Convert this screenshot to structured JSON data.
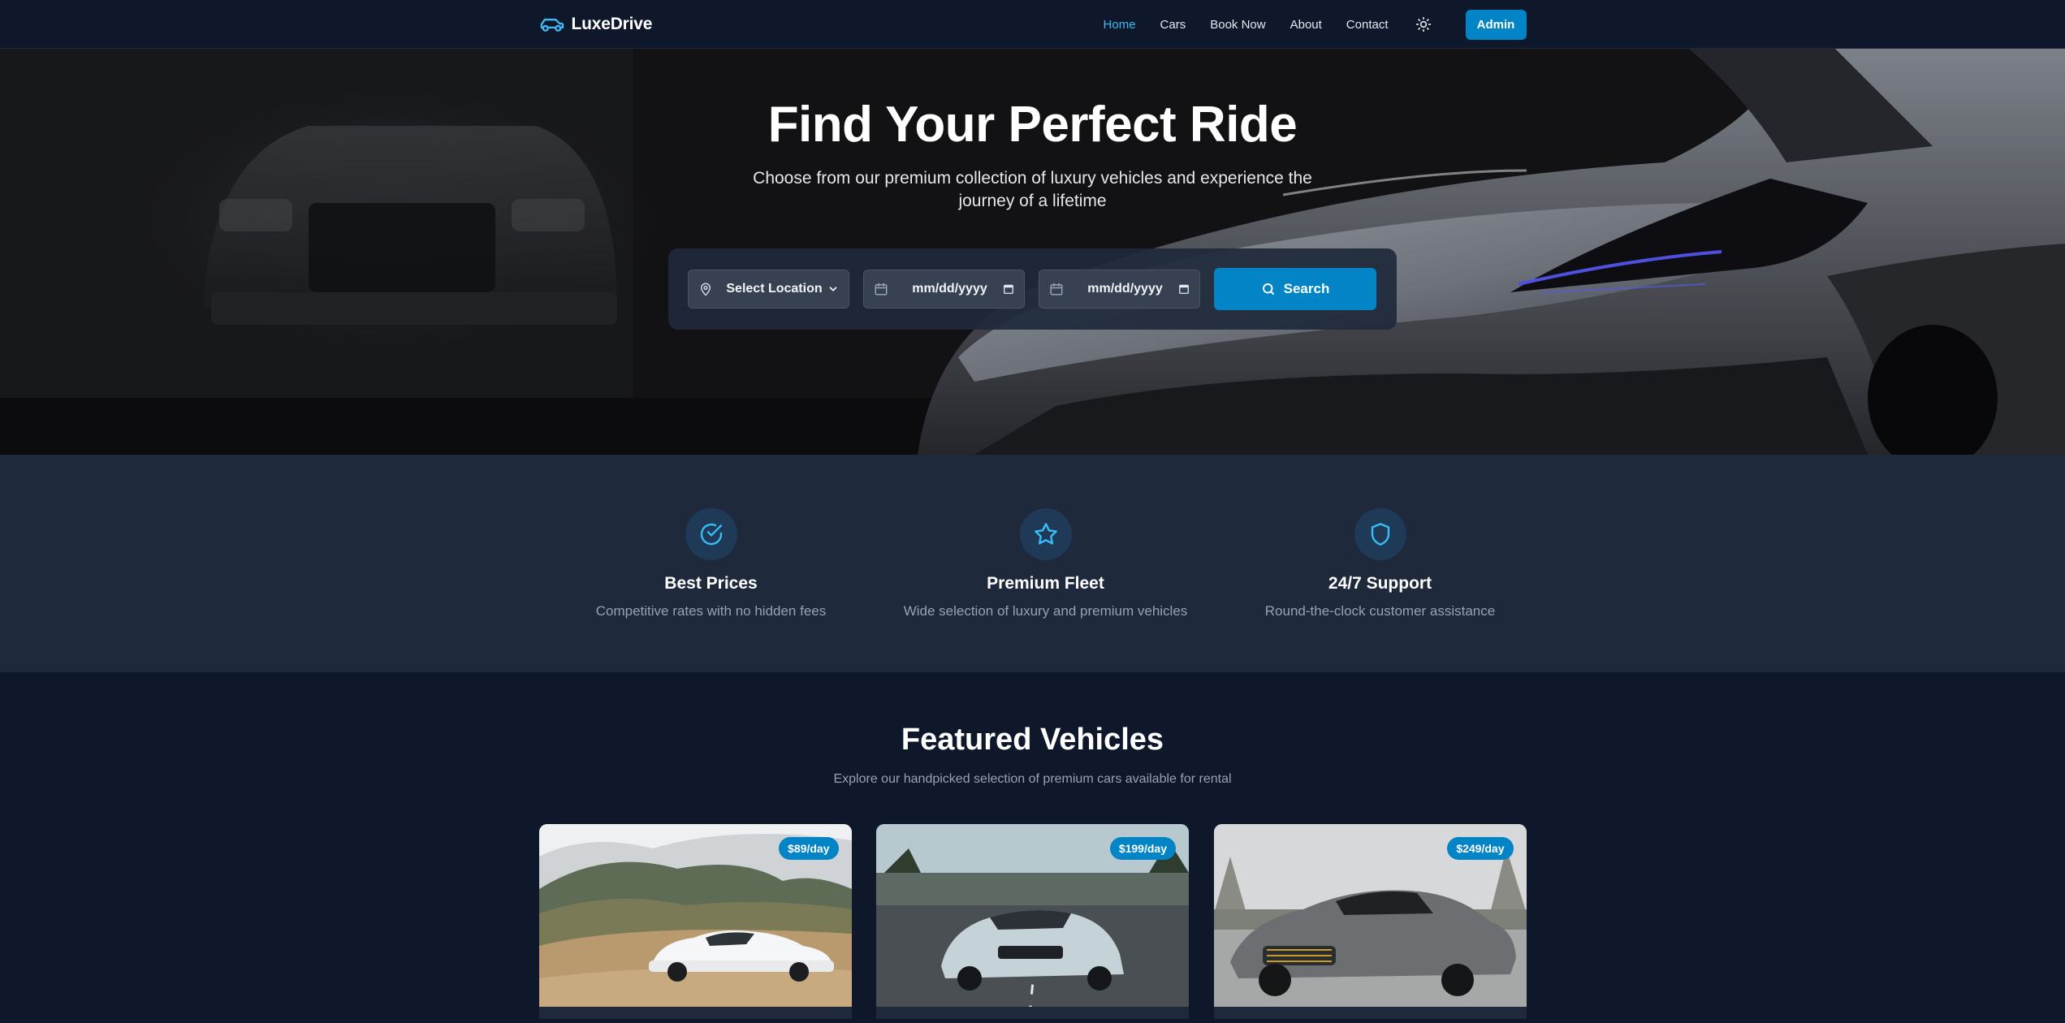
{
  "brand": {
    "name": "LuxeDrive",
    "icon": "car-icon"
  },
  "nav": {
    "links": [
      "Home",
      "Cars",
      "Book Now",
      "About",
      "Contact"
    ],
    "active": "Home",
    "theme_icon": "sun-icon",
    "admin_label": "Admin"
  },
  "hero": {
    "title": "Find Your Perfect Ride",
    "subtitle": "Choose from our premium collection of luxury vehicles and experience the journey of a lifetime",
    "search": {
      "location_placeholder": "Select Location",
      "pickup_date_placeholder": "mm/dd/yyyy",
      "return_date_placeholder": "mm/dd/yyyy",
      "button_label": "Search"
    }
  },
  "features": [
    {
      "icon": "check-circle-icon",
      "title": "Best Prices",
      "description": "Competitive rates with no hidden fees"
    },
    {
      "icon": "star-icon",
      "title": "Premium Fleet",
      "description": "Wide selection of luxury and premium vehicles"
    },
    {
      "icon": "shield-icon",
      "title": "24/7 Support",
      "description": "Round-the-clock customer assistance"
    }
  ],
  "featured": {
    "title": "Featured Vehicles",
    "subtitle": "Explore our handpicked selection of premium cars available for rental",
    "cars": [
      {
        "price": "$89/day"
      },
      {
        "price": "$199/day"
      },
      {
        "price": "$249/day"
      }
    ]
  },
  "colors": {
    "background": "#0f172a",
    "surface": "#1e293b",
    "accent": "#0284c7",
    "accent_light": "#38bdf8"
  }
}
